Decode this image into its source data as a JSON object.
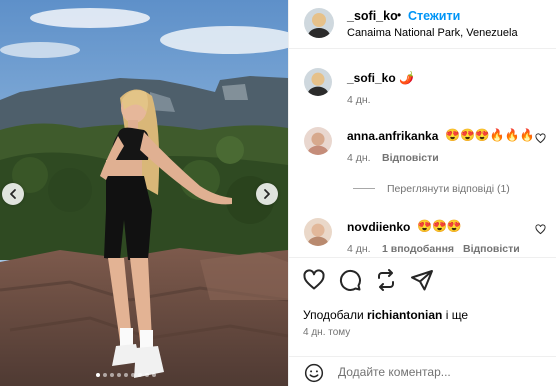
{
  "post": {
    "header": {
      "username": "_sofi_ko",
      "separator": "•",
      "follow_label": "Стежити",
      "location": "Canaima National Park, Venezuela"
    },
    "caption": {
      "username": "_sofi_ko",
      "text": "🌶️",
      "age": "4 дн."
    },
    "comments": [
      {
        "username": "anna.anfrikanka",
        "text": "😍😍😍🔥🔥🔥",
        "age": "4 дн.",
        "reply_label": "Відповісти"
      },
      {
        "username": "novdiienko",
        "text": "😍😍😍",
        "age": "4 дн.",
        "likes_label": "1 вподобання",
        "reply_label": "Відповісти"
      }
    ],
    "view_replies_label": "Переглянути відповіді (1)",
    "likes": {
      "prefix": "Уподобали",
      "user": "richiantonian",
      "suffix": "і ще"
    },
    "timestamp": "4 дн. тому",
    "comment_placeholder": "Додайте коментар...",
    "carousel": {
      "slide_count": 9,
      "active_index": 0
    }
  },
  "colors": {
    "accent": "#0095f6",
    "secondary_text": "#737373",
    "border": "#efefef"
  },
  "icons": {
    "actions": [
      "heart-icon",
      "comment-icon",
      "share-repost-icon",
      "send-icon"
    ],
    "carousel": [
      "chevron-left-icon",
      "chevron-right-icon"
    ],
    "composer": "emoji-icon"
  }
}
